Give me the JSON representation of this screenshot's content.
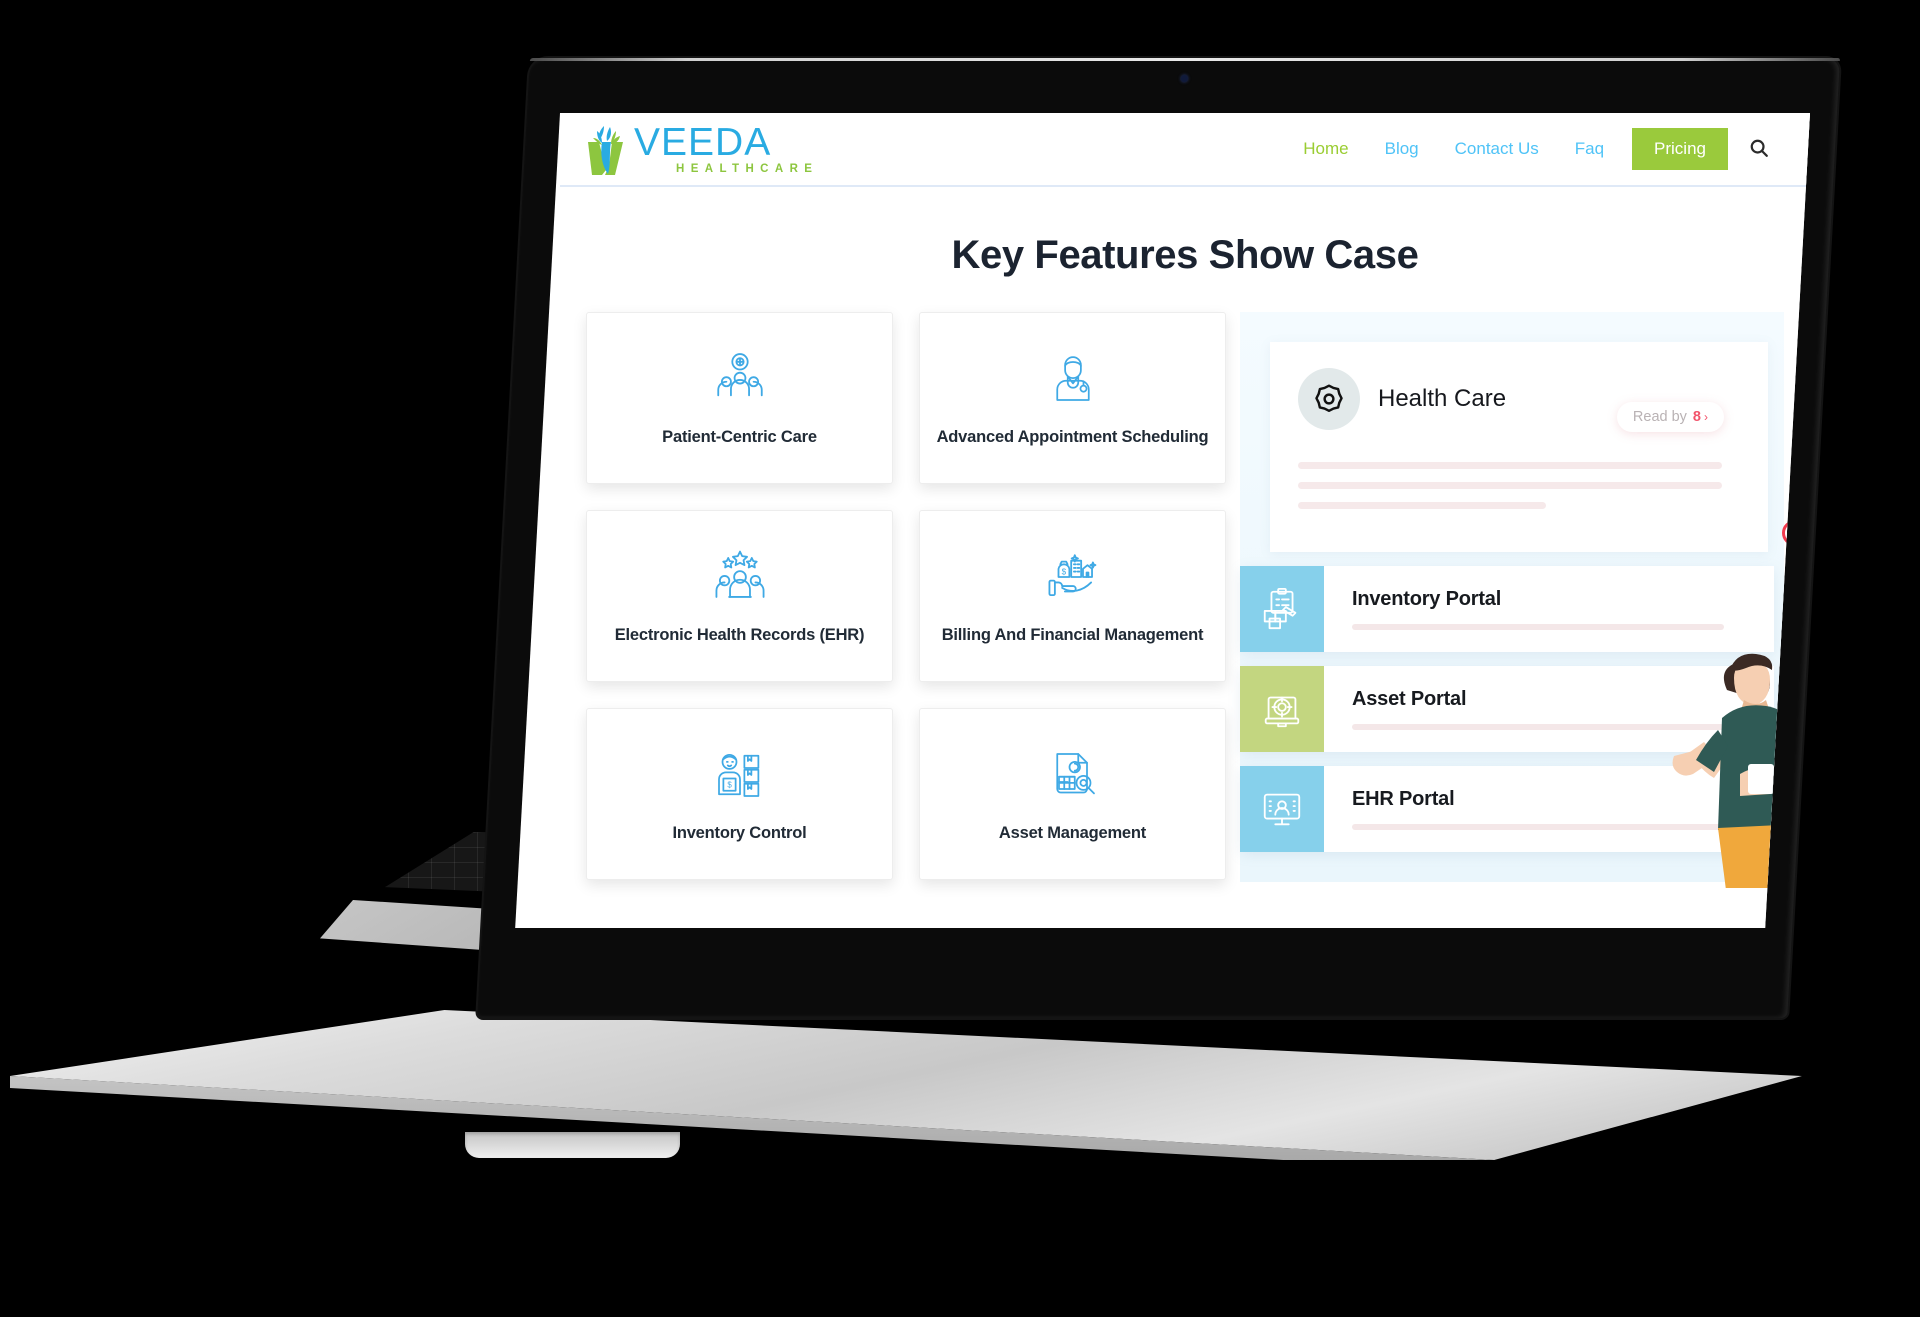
{
  "brand": {
    "name": "VEEDA",
    "tagline": "HEALTHCARE",
    "name_color": "#29ABE2",
    "tagline_color": "#8DC63F"
  },
  "nav": {
    "items": [
      {
        "label": "Home",
        "active": true
      },
      {
        "label": "Blog",
        "active": false
      },
      {
        "label": "Contact Us",
        "active": false
      },
      {
        "label": "Faq",
        "active": false
      }
    ],
    "pricing_label": "Pricing",
    "pricing_bg": "#9ACA3C",
    "link_color": "#4FC3F7",
    "active_color": "#9ACD32",
    "search_icon": "search-icon"
  },
  "page": {
    "title": "Key Features Show Case"
  },
  "features": [
    {
      "title": "Patient-Centric Care",
      "icon": "people-shield-icon"
    },
    {
      "title": "Advanced Appointment Scheduling",
      "icon": "doctor-stethoscope-icon"
    },
    {
      "title": "Electronic Health Records (EHR)",
      "icon": "people-stars-icon"
    },
    {
      "title": "Billing And Financial Management",
      "icon": "hand-money-building-icon"
    },
    {
      "title": "Inventory Control",
      "icon": "worker-boxes-icon"
    },
    {
      "title": "Asset Management",
      "icon": "document-magnifier-icon"
    }
  ],
  "panel": {
    "health_card": {
      "icon": "gear-icon",
      "title": "Health Care",
      "read_by_label": "Read by",
      "read_by_count": "8",
      "chevron": "›",
      "accent_color": "#f2546b"
    },
    "portals": [
      {
        "name": "Inventory Portal",
        "icon": "clipboard-boxes-icon",
        "swatch": "#86D0EB",
        "theme": "blue"
      },
      {
        "name": "Asset Portal",
        "icon": "projector-icon",
        "swatch": "#C3D680",
        "theme": "green"
      },
      {
        "name": "EHR Portal",
        "icon": "monitor-user-icon",
        "swatch": "#86D0EB",
        "theme": "blue"
      }
    ],
    "illustration": {
      "name": "person-waving-illustration",
      "heart_badge": "heart-icon",
      "heart_color": "#F23B4E",
      "shirt_color": "#2F5A55",
      "pants_color": "#F0A83C",
      "hair_color": "#3B2A24",
      "skin_color": "#F6CFB2"
    }
  },
  "device": {
    "name": "laptop-mockup",
    "webcam": "webcam-dot"
  }
}
